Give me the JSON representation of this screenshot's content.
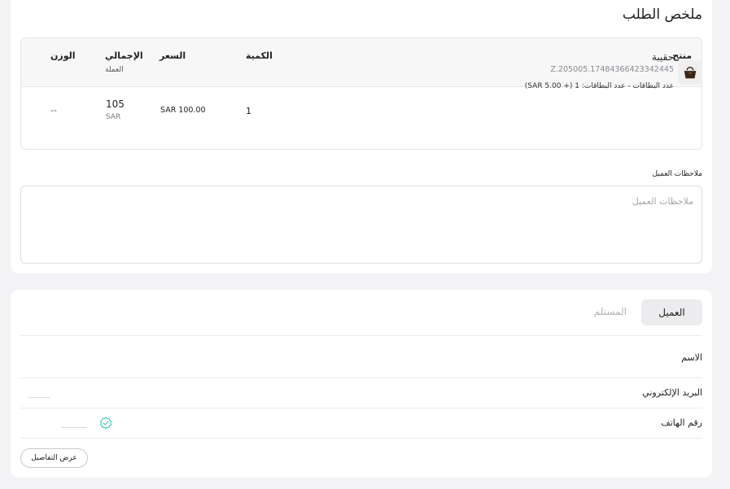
{
  "order_summary": {
    "title": "ملخص الطلب",
    "columns": {
      "product": "منتج",
      "quantity": "الكمية",
      "price": "السعر",
      "total": "الإجمالي",
      "total_sub": "العملة",
      "weight": "الوزن"
    },
    "items": [
      {
        "name": "حقيبة",
        "sku": "Z.205005.17484366423342445",
        "options": "عدد البطاقات - عدد البطاقات: 1 (+ SAR 5.00)",
        "quantity": "1",
        "price": "SAR 100.00",
        "total": "105",
        "currency": "SAR",
        "weight": "--",
        "thumbnail_icon": "handbag-icon"
      }
    ],
    "notes_label": "ملاحظات العميل",
    "notes_placeholder": "ملاحظات العميل",
    "notes_value": ""
  },
  "customer_section": {
    "tabs": [
      {
        "label": "العميل",
        "active": true
      },
      {
        "label": "المستلم",
        "active": false
      }
    ],
    "fields": {
      "name_label": "الاسم",
      "email_label": "البريد الإلكتروني",
      "phone_label": "رقم الهاتف"
    },
    "phone_verified_icon": "verified-check-icon",
    "verified_color": "#3cc9b4",
    "details_button": "عرض التفاصيل"
  }
}
